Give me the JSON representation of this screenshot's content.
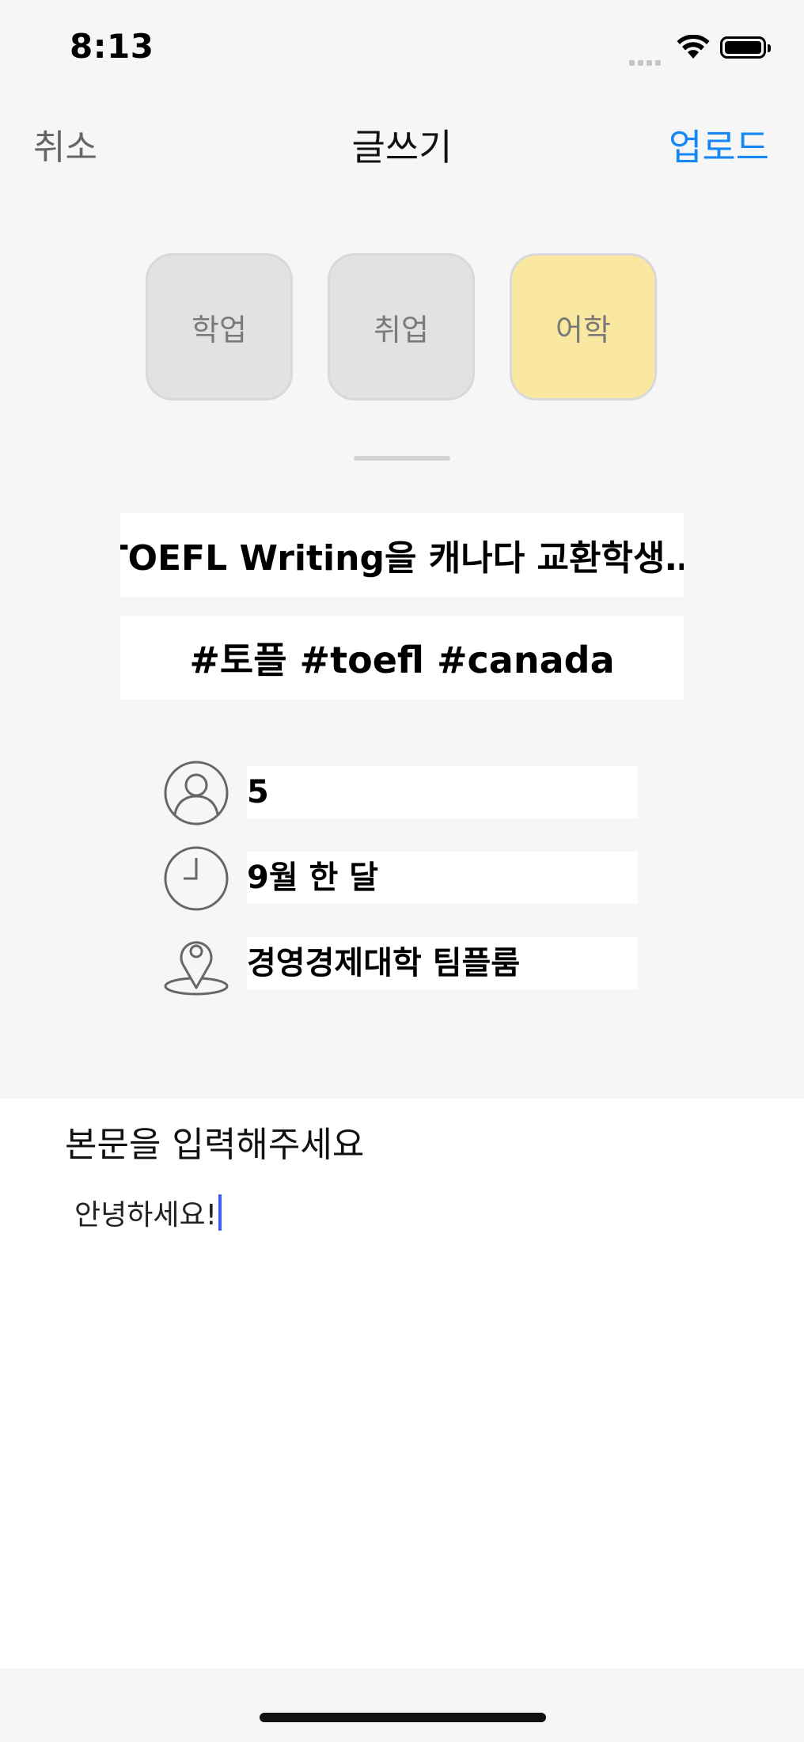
{
  "status_bar": {
    "time": "8:13"
  },
  "nav": {
    "cancel_label": "취소",
    "title": "글쓰기",
    "upload_label": "업로드"
  },
  "categories": [
    {
      "label": "학업",
      "selected": false
    },
    {
      "label": "취업",
      "selected": false
    },
    {
      "label": "어학",
      "selected": true
    }
  ],
  "colors": {
    "accent": "#1787f5",
    "selected_category": "#fae8a1",
    "unselected_category": "#e2e2e2",
    "cursor": "#3b5ef2"
  },
  "post": {
    "title": "TOEFL Writing을 캐나다 교환학생…",
    "tags": "#토플 #toefl #canada",
    "members": "5",
    "period": "9월 한 달",
    "location": "경영경제대학 팀플룸"
  },
  "icons": {
    "members": "person-icon",
    "period": "clock-icon",
    "location": "location-pin-icon"
  },
  "body": {
    "label": "본문을 입력해주세요",
    "text": "안녕하세요!"
  }
}
